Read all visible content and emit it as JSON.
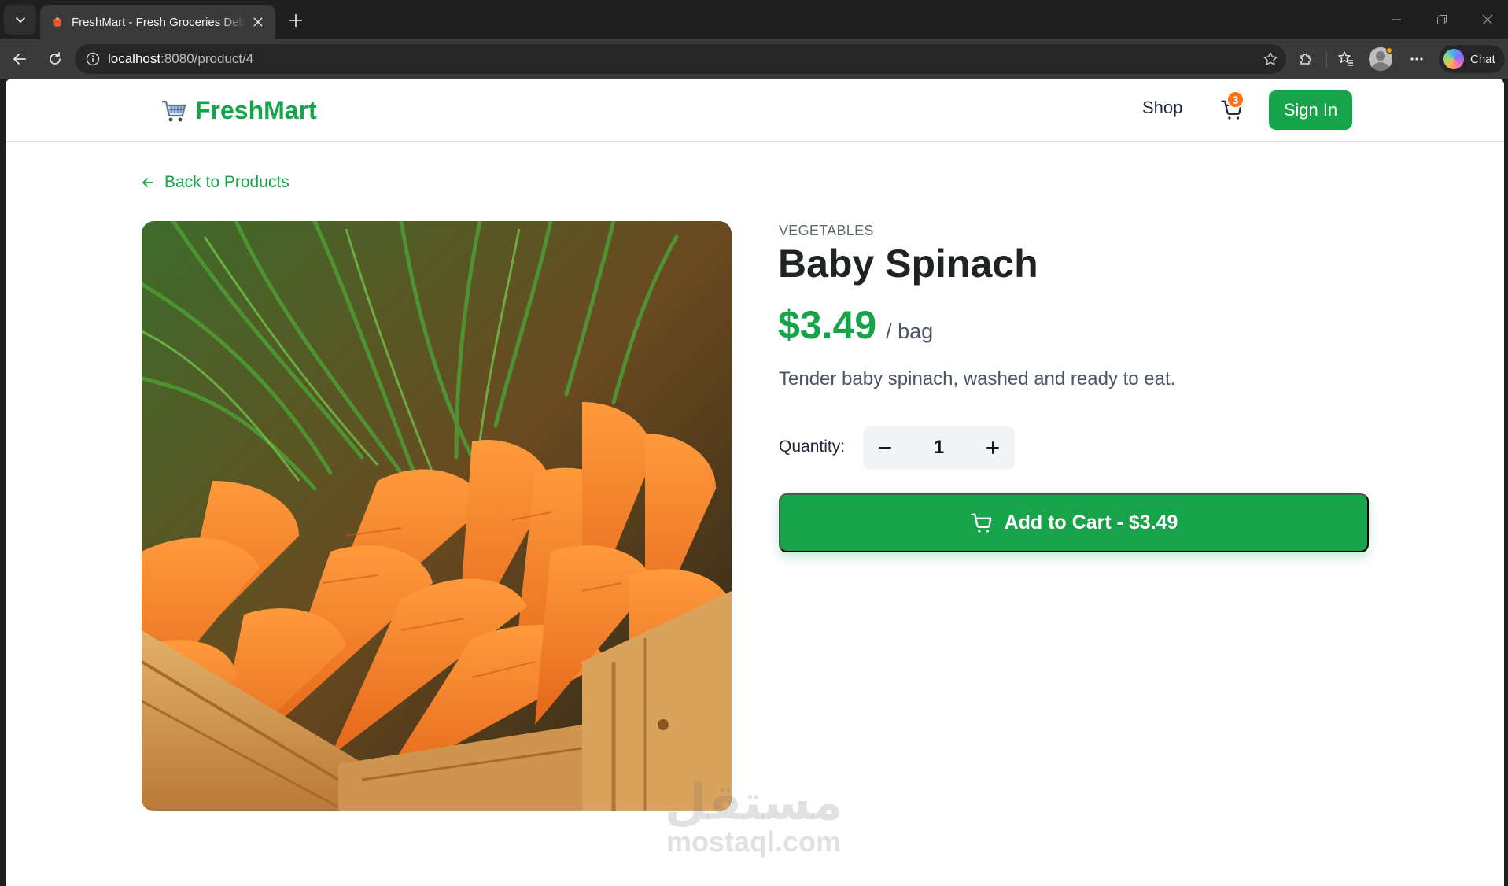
{
  "browser": {
    "tab_title": "FreshMart - Fresh Groceries Delivered",
    "url_host": "localhost",
    "url_path": ":8080/product/4",
    "chat_label": "Chat"
  },
  "header": {
    "brand": "FreshMart",
    "nav_shop": "Shop",
    "cart_count": "3",
    "sign_in": "Sign In"
  },
  "back_link": "Back to Products",
  "product": {
    "category": "VEGETABLES",
    "name": "Baby Spinach",
    "price": "$3.49",
    "unit": "/ bag",
    "description": "Tender baby spinach, washed and ready to eat.",
    "quantity_label": "Quantity:",
    "quantity": "1",
    "add_to_cart_label": "Add to Cart - $3.49",
    "image_subject": "carrots in a wooden crate"
  },
  "watermark": {
    "arabic": "مستقل",
    "latin": "mostaql.com"
  },
  "colors": {
    "brand_green": "#16a34a",
    "cart_badge": "#f97316"
  }
}
